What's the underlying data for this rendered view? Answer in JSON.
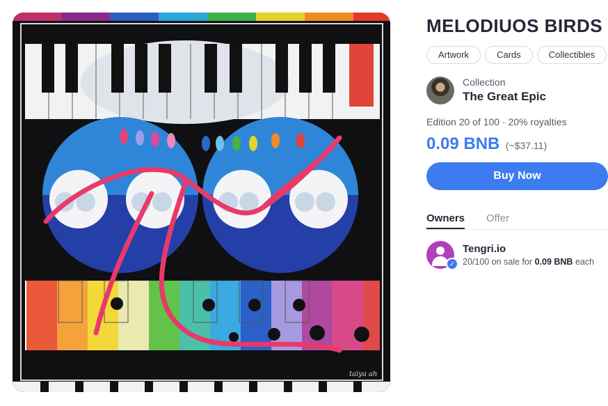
{
  "artwork": {
    "alt": "MELODIUOS BIRDS artwork",
    "signature": "taiya ah"
  },
  "title": "MELODIUOS BIRDS",
  "tags": [
    "Artwork",
    "Cards",
    "Collectibles"
  ],
  "collection": {
    "label": "Collection",
    "name": "The Great Epic"
  },
  "edition": "Edition 20 of 100 · 20% royalties",
  "price": {
    "amount": "0.09 BNB",
    "usd": "(~$37.11)"
  },
  "buy_label": "Buy Now",
  "tabs": {
    "owners": "Owners",
    "offer": "Offer"
  },
  "owner": {
    "name": "Tengri.io",
    "sale_prefix": "20/100 on sale for",
    "sale_price": "0.09 BNB",
    "sale_suffix": "each"
  },
  "colors": {
    "accent": "#3d7bf0",
    "owner_avatar": "#b23fb8"
  },
  "icons": {
    "verified": "verified-check-icon",
    "owner": "user-avatar-icon"
  }
}
